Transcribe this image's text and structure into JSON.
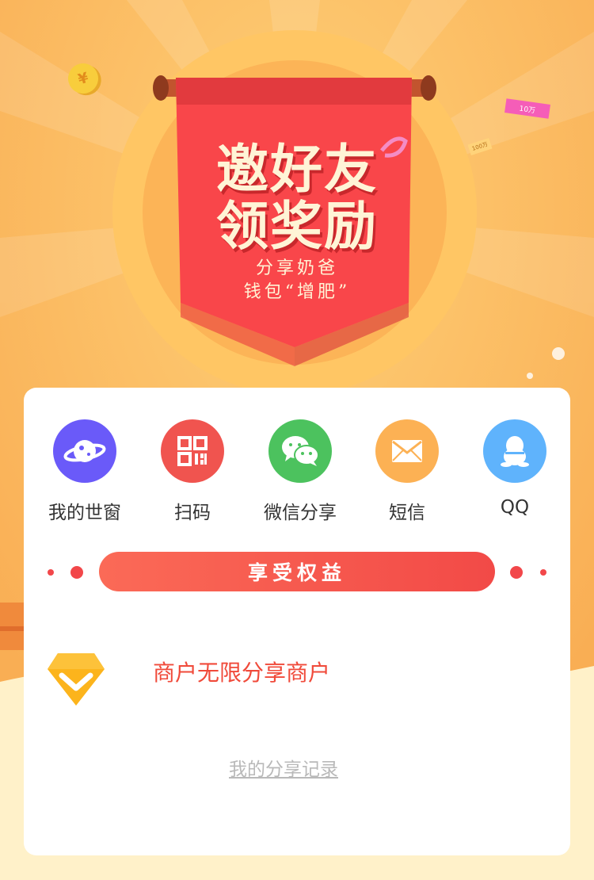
{
  "banner": {
    "title_line1": "邀好友",
    "title_line2": "领奖励",
    "subtitle_line1": "分享奶爸",
    "subtitle_line2": "钱包“增肥”",
    "coin_symbol": "¥",
    "ticket_pink": "10万",
    "ticket_gold": "100万"
  },
  "share": {
    "items": [
      {
        "label": "我的世窗",
        "icon": "planet-icon",
        "color": "#6a5af9"
      },
      {
        "label": "扫码",
        "icon": "qrcode-icon",
        "color": "#f0544f"
      },
      {
        "label": "微信分享",
        "icon": "wechat-icon",
        "color": "#4cc25e"
      },
      {
        "label": "短信",
        "icon": "envelope-icon",
        "color": "#fcb154"
      },
      {
        "label": "QQ",
        "icon": "qq-penguin-icon",
        "color": "#5fb3fc"
      }
    ]
  },
  "benefits": {
    "button_label": "享受权益",
    "item_text": "商户无限分享商户",
    "item_icon": "diamond-check-icon",
    "record_link": "我的分享记录"
  },
  "colors": {
    "accent_red": "#f24a47",
    "banner_bg": "#fbc166",
    "card_bg": "#ffffff"
  }
}
